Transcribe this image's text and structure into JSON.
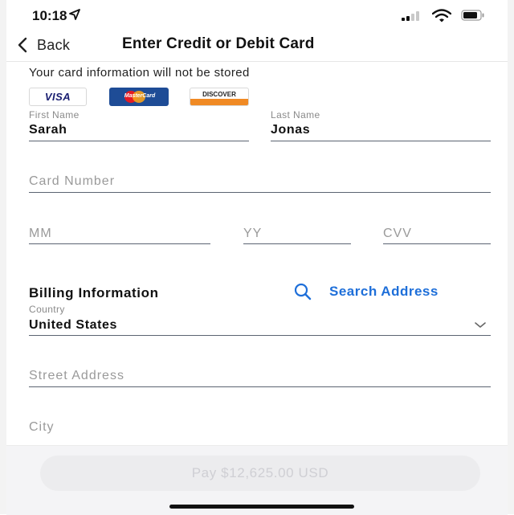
{
  "status_bar": {
    "time": "10:18",
    "icons": [
      "location-arrow-icon",
      "signal-icon",
      "wifi-icon",
      "battery-icon"
    ]
  },
  "nav": {
    "back_label": "Back",
    "title": "Enter Credit or Debit Card"
  },
  "notice": "Your card information will not be stored",
  "card_brands": {
    "visa": "VISA",
    "mastercard": "MasterCard",
    "discover": "DISCOVER"
  },
  "form": {
    "first_name": {
      "label": "First Name",
      "value": "Sarah"
    },
    "last_name": {
      "label": "Last Name",
      "value": "Jonas"
    },
    "card_number": {
      "placeholder": "Card Number"
    },
    "month": {
      "placeholder": "MM"
    },
    "year": {
      "placeholder": "YY"
    },
    "cvv": {
      "placeholder": "CVV"
    }
  },
  "billing": {
    "heading": "Billing Information",
    "search_label": "Search Address",
    "country": {
      "label": "Country",
      "value": "United States"
    },
    "street": {
      "placeholder": "Street Address"
    },
    "city": {
      "placeholder": "City"
    }
  },
  "pay_button": "Pay $12,625.00 USD",
  "colors": {
    "accent": "#1e6fd9",
    "underline": "#5b6472",
    "placeholder": "#9a9a9a",
    "pay_disabled_bg": "#ececee",
    "pay_disabled_text": "#cfcfd4"
  }
}
